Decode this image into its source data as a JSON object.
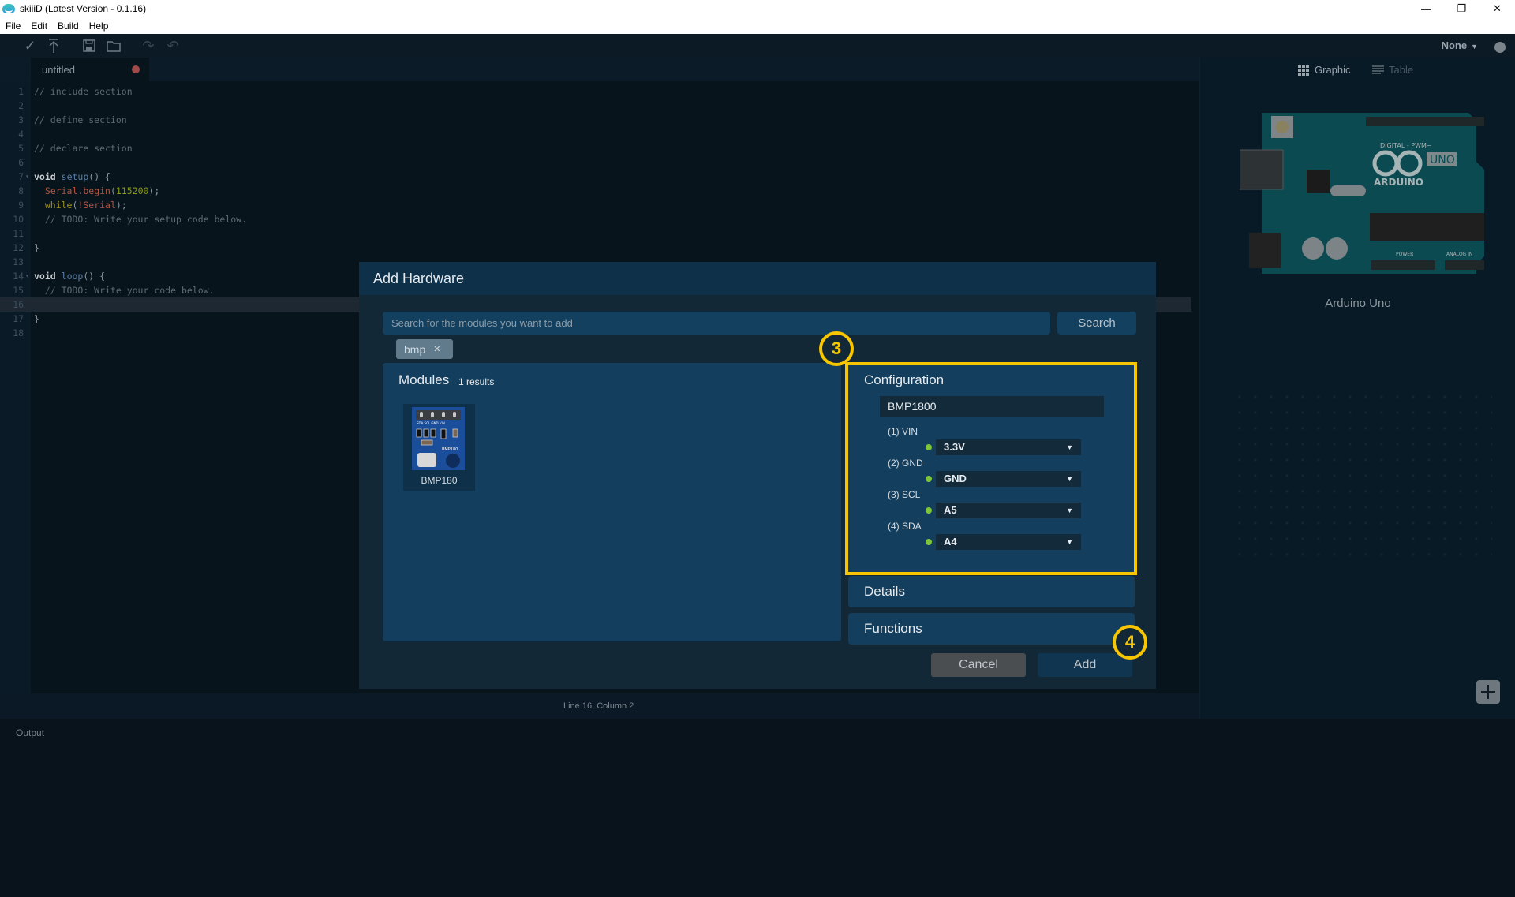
{
  "window": {
    "title": "skiiiD (Latest Version - 0.1.16)",
    "controls": {
      "minimize": "—",
      "restore": "❐",
      "close": "✕"
    }
  },
  "menu": [
    "File",
    "Edit",
    "Build",
    "Help"
  ],
  "toolbar": {
    "icons": [
      "check-icon",
      "upload-icon",
      "save-icon",
      "folder-icon",
      "redo-icon",
      "undo-icon"
    ],
    "board_select": "None"
  },
  "editor": {
    "tab": {
      "label": "untitled",
      "unsaved": true
    },
    "lines": [
      {
        "n": "1",
        "html": "<span class=\"cm\">// include section</span>"
      },
      {
        "n": "2",
        "html": ""
      },
      {
        "n": "3",
        "html": "<span class=\"cm\">// define section</span>"
      },
      {
        "n": "4",
        "html": ""
      },
      {
        "n": "5",
        "html": "<span class=\"cm\">// declare section</span>"
      },
      {
        "n": "6",
        "html": ""
      },
      {
        "n": "7",
        "fold": true,
        "html": "<span class=\"kw\">void</span> <span class=\"fn\">setup</span><span class=\"pl\">() {</span>"
      },
      {
        "n": "8",
        "html": "  <span class=\"obj\">Serial</span><span class=\"pl\">.</span><span class=\"obj\">begin</span><span class=\"pl\">(</span><span class=\"num\">115200</span><span class=\"pl\">);</span>"
      },
      {
        "n": "9",
        "html": "  <span class=\"wh\">while</span><span class=\"pl\">(</span><span class=\"obj\">!Serial</span><span class=\"pl\">);</span>"
      },
      {
        "n": "10",
        "html": "  <span class=\"cm\">// TODO: Write your setup code below.</span>"
      },
      {
        "n": "11",
        "html": ""
      },
      {
        "n": "12",
        "html": "<span class=\"pl\">}</span>"
      },
      {
        "n": "13",
        "html": ""
      },
      {
        "n": "14",
        "fold": true,
        "html": "<span class=\"kw\">void</span> <span class=\"fn\">loop</span><span class=\"pl\">() {</span>"
      },
      {
        "n": "15",
        "html": "  <span class=\"cm\">// TODO: Write your code below.</span>"
      },
      {
        "n": "16",
        "active": true,
        "html": ""
      },
      {
        "n": "17",
        "html": "<span class=\"pl\">}</span>"
      },
      {
        "n": "18",
        "html": ""
      }
    ],
    "cursor_position": "Line 16, Column 2"
  },
  "output": {
    "label": "Output"
  },
  "hardware_panel": {
    "views": {
      "graphic": "Graphic",
      "table": "Table"
    },
    "board_name": "Arduino Uno",
    "board_image": "arduino-uno-board"
  },
  "dialog": {
    "title": "Add Hardware",
    "search_placeholder": "Search for the modules you want to add",
    "search_value": "",
    "search_button": "Search",
    "filter_chip": "bmp",
    "modules": {
      "title": "Modules",
      "count": "1 results",
      "items": [
        {
          "name": "BMP180",
          "image": "bmp180-module"
        }
      ]
    },
    "configuration": {
      "title": "Configuration",
      "instance_name": "BMP1800",
      "pins": [
        {
          "label": "(1) VIN",
          "value": "3.3V"
        },
        {
          "label": "(2) GND",
          "value": "GND"
        },
        {
          "label": "(3) SCL",
          "value": "A5"
        },
        {
          "label": "(4) SDA",
          "value": "A4"
        }
      ]
    },
    "details_title": "Details",
    "functions_title": "Functions",
    "cancel_button": "Cancel",
    "add_button": "Add"
  },
  "annotations": {
    "color": "#f7c600",
    "steps": [
      "3",
      "4"
    ]
  }
}
